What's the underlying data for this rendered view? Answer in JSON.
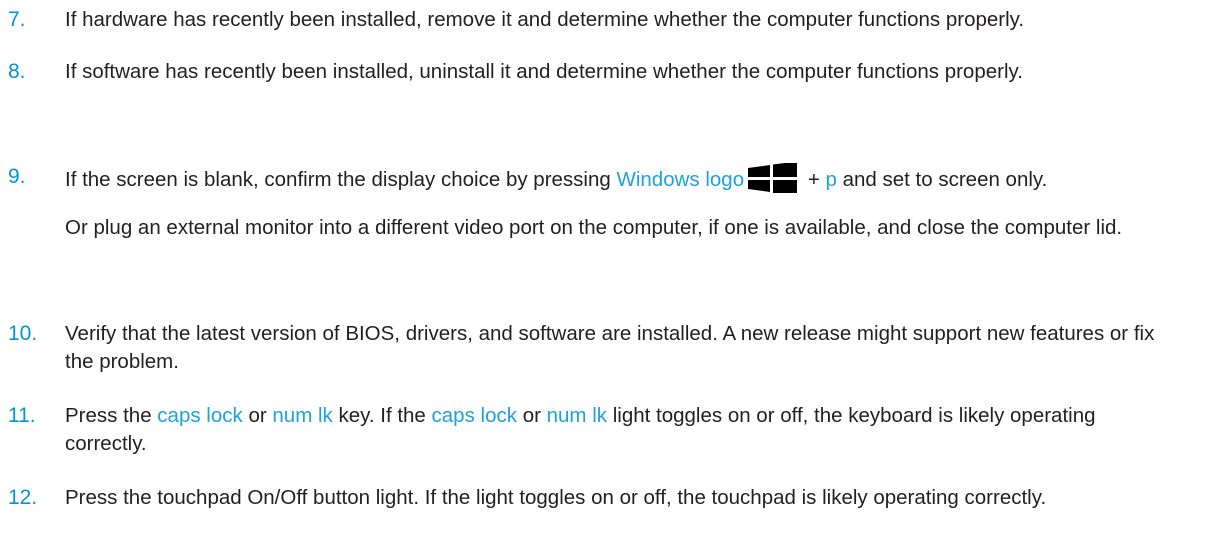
{
  "colors": {
    "accent": "#0096d6",
    "keyword": "#1ea2de",
    "text": "#231f20"
  },
  "steps": [
    {
      "number": "7.",
      "text": "If hardware has recently been installed, remove it and determine whether the computer functions properly."
    },
    {
      "number": "8.",
      "text": "If software has recently been installed, uninstall it and determine whether the computer functions properly."
    },
    {
      "number": "9.",
      "text_before": "If the screen is blank, confirm the display choice by pressing ",
      "key_windows": "Windows logo",
      "icon": "windows-logo-icon",
      "plus": " + ",
      "key_p": "p",
      "text_after": " and set to screen only.",
      "para2": "Or plug an external monitor into a different video port on the computer, if one is available, and close the computer lid."
    },
    {
      "number": "10.",
      "text": "Verify that the latest version of BIOS, drivers, and software are installed. A new release might support new features or fix the problem."
    },
    {
      "number": "11.",
      "t1": "Press the ",
      "k1": "caps lock",
      "t2": " or ",
      "k2": "num lk",
      "t3": " key. If the ",
      "k3": "caps lock",
      "t4": " or ",
      "k4": "num lk",
      "t5": " light toggles on or off, the keyboard is likely operating correctly."
    },
    {
      "number": "12.",
      "text": "Press the touchpad On/Off button light. If the light toggles on or off, the touchpad is likely operating correctly."
    }
  ]
}
